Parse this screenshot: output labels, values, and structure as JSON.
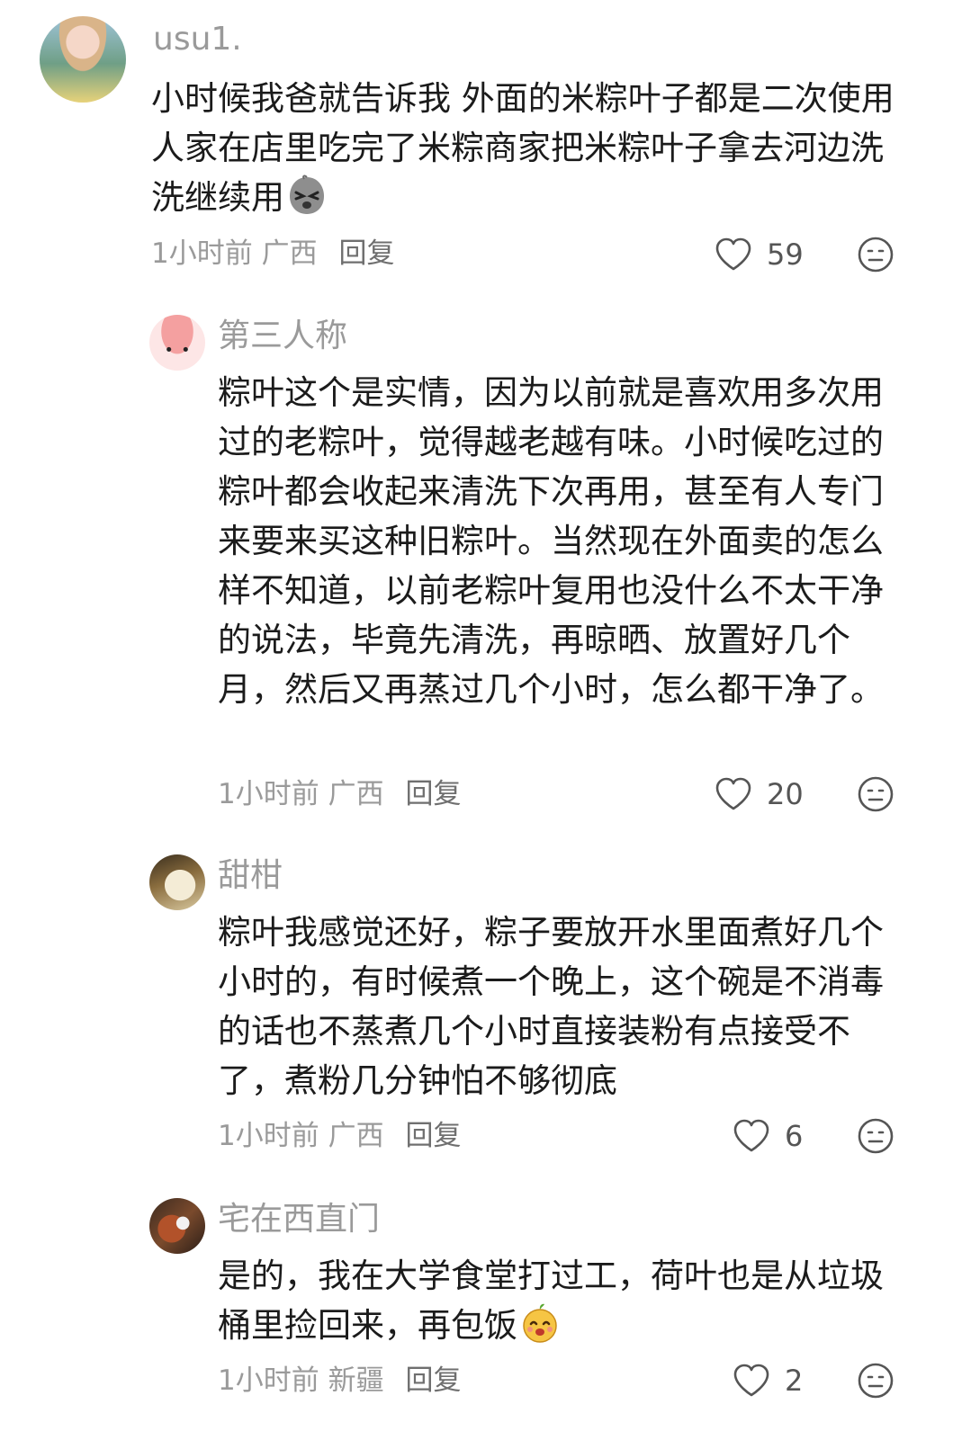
{
  "comments": [
    {
      "username": "usu1.",
      "text": "小时候我爸就告诉我 外面的米粽叶子都是二次使用人家在店里吃完了米粽商家把米粽叶子拿去河边洗洗继续用",
      "emoji": "squinting-ghost-emoji",
      "time": "1小时前",
      "location": "广西",
      "reply_label": "回复",
      "likes": "59"
    },
    {
      "username": "第三人称",
      "text": "粽叶这个是实情，因为以前就是喜欢用多次用过的老粽叶，觉得越老越有味。小时候吃过的粽叶都会收起来清洗下次再用，甚至有人专门来要来买这种旧粽叶。当然现在外面卖的怎么样不知道，以前老粽叶复用也没什么不太干净的说法，毕竟先清洗，再晾晒、放置好几个月，然后又再蒸过几个小时，怎么都干净了。",
      "time": "1小时前",
      "location": "广西",
      "reply_label": "回复",
      "likes": "20"
    },
    {
      "username": "甜柑",
      "text": "粽叶我感觉还好，粽子要放开水里面煮好几个小时的，有时候煮一个晚上，这个碗是不消毒的话也不蒸煮几个小时直接装粉有点接受不了，煮粉几分钟怕不够彻底",
      "time": "1小时前",
      "location": "广西",
      "reply_label": "回复",
      "likes": "6"
    },
    {
      "username": "宅在西直门",
      "text": "是的，我在大学食堂打过工，荷叶也是从垃圾桶里捡回来，再包饭",
      "emoji": "happy-sprout-emoji",
      "time": "1小时前",
      "location": "新疆",
      "reply_label": "回复",
      "likes": "2"
    }
  ],
  "icons": {
    "like": "heart-outline-icon",
    "dislike": "dislike-face-icon"
  },
  "colors": {
    "meta_text": "#9a9a9a",
    "body_text": "#1b1b1b",
    "icon_stroke": "#555555"
  }
}
